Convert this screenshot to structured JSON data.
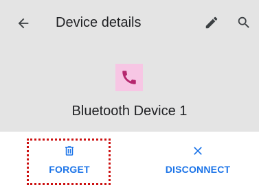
{
  "app_bar": {
    "title": "Device details",
    "back_icon": "arrow-back-icon",
    "edit_icon": "pencil-icon",
    "search_icon": "search-icon"
  },
  "device": {
    "name": "Bluetooth Device 1",
    "icon": "phone-icon",
    "icon_bg_color": "#f7c6e4",
    "icon_color": "#b5276e"
  },
  "actions": {
    "forget": {
      "label": "FORGET",
      "icon": "trash-icon"
    },
    "disconnect": {
      "label": "DISCONNECT",
      "icon": "close-icon"
    }
  },
  "colors": {
    "header_bg": "#e4e4e4",
    "accent": "#1a73e8",
    "highlight": "#cc1111"
  }
}
